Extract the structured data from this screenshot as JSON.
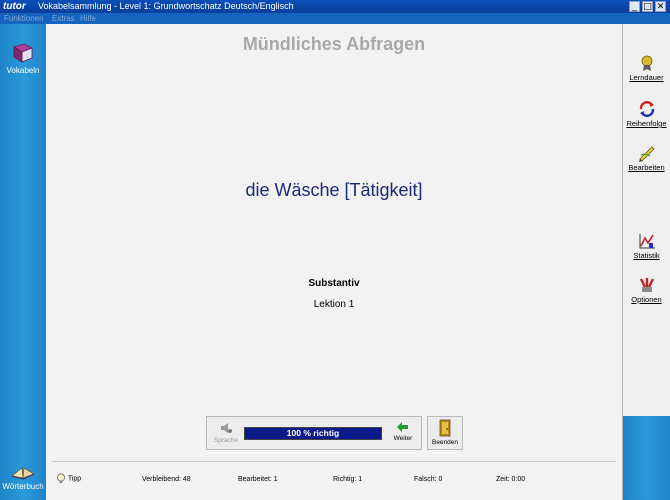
{
  "window": {
    "logo": "tutor",
    "title": "Vokabelsammlung - Level 1: Grundwortschatz Deutsch/Englisch",
    "controls": {
      "minimize": "_",
      "maximize": "□",
      "close": "✕"
    }
  },
  "menu": [
    "Funktionen",
    "Extras",
    "Hilfe"
  ],
  "left_sidebar": {
    "top_item": {
      "label": "Vokabeln",
      "icon": "book-icon"
    },
    "bottom_item": {
      "label": "Wörterbuch",
      "icon": "open-book-icon"
    }
  },
  "right_toolbar": [
    {
      "label": "Lerndauer",
      "icon": "medal-icon"
    },
    {
      "label": "Reihenfolge",
      "icon": "cycle-arrows-icon"
    },
    {
      "label": "Bearbeiten",
      "icon": "pencil-icon"
    },
    {
      "label": "Statistik",
      "icon": "chart-icon"
    },
    {
      "label": "Optionen",
      "icon": "tools-icon"
    }
  ],
  "main": {
    "heading": "Mündliches Abfragen",
    "word": "die Wäsche [Tätigkeit]",
    "word_type": "Substantiv",
    "lesson": "Lektion 1"
  },
  "controls": {
    "sprache_label": "Sprache",
    "progress_text": "100 % richtig",
    "progress_percent": 100,
    "weiter_label": "Weiter",
    "beenden_label": "Beenden"
  },
  "status": {
    "tip_label": "Tipp",
    "remaining": "Verbleibend: 48",
    "edited": "Bearbeitet: 1",
    "correct": "Richtig: 1",
    "wrong": "Falsch: 0",
    "time": "Zeit: 0:00"
  },
  "colors": {
    "accent": "#1a5fb4",
    "word": "#1a2a7a",
    "progress": "#0b1c8a",
    "heading": "#a8a8a8"
  }
}
